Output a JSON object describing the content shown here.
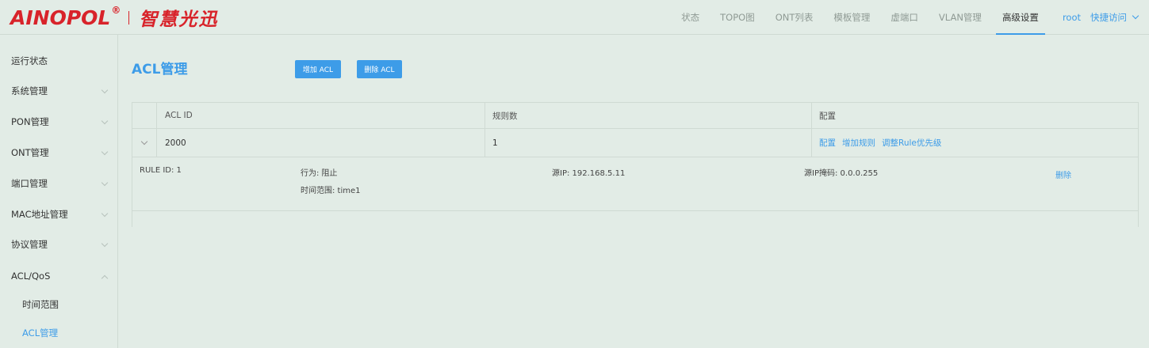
{
  "logo": {
    "brand": "AINOPOL",
    "registered": "®",
    "cn": "智慧光迅"
  },
  "nav": {
    "items": [
      {
        "label": "状态",
        "active": false
      },
      {
        "label": "TOPO图",
        "active": false
      },
      {
        "label": "ONT列表",
        "active": false
      },
      {
        "label": "模板管理",
        "active": false
      },
      {
        "label": "虚端口",
        "active": false
      },
      {
        "label": "VLAN管理",
        "active": false
      },
      {
        "label": "高级设置",
        "active": true
      }
    ],
    "user": "root",
    "quick_access": "快捷访问"
  },
  "sidebar": {
    "items": [
      {
        "label": "运行状态",
        "arrow": "none"
      },
      {
        "label": "系统管理",
        "arrow": "down"
      },
      {
        "label": "PON管理",
        "arrow": "down"
      },
      {
        "label": "ONT管理",
        "arrow": "down"
      },
      {
        "label": "端口管理",
        "arrow": "down"
      },
      {
        "label": "MAC地址管理",
        "arrow": "down"
      },
      {
        "label": "协议管理",
        "arrow": "down"
      },
      {
        "label": "ACL/QoS",
        "arrow": "up"
      }
    ],
    "subitems": [
      {
        "label": "时间范围",
        "active": false
      },
      {
        "label": "ACL管理",
        "active": true
      }
    ]
  },
  "main": {
    "title": "ACL管理",
    "add_button": "增加 ACL",
    "delete_button": "删除 ACL",
    "table": {
      "headers": [
        "ACL ID",
        "规则数",
        "配置"
      ],
      "rows": [
        {
          "acl_id": "2000",
          "rule_count": "1",
          "actions": [
            "配置",
            "增加规则",
            "调整Rule优先级"
          ],
          "rule": {
            "rule_id": "RULE ID: 1",
            "action": "行为: 阻止",
            "time_range": "时间范围: time1",
            "src_ip": "源IP: 192.168.5.11",
            "src_mask": "源IP掩码: 0.0.0.255",
            "delete": "删除"
          }
        }
      ]
    }
  },
  "colors": {
    "accent": "#3d9ce8",
    "brand": "#d8232a",
    "background": "#e2ece6"
  }
}
